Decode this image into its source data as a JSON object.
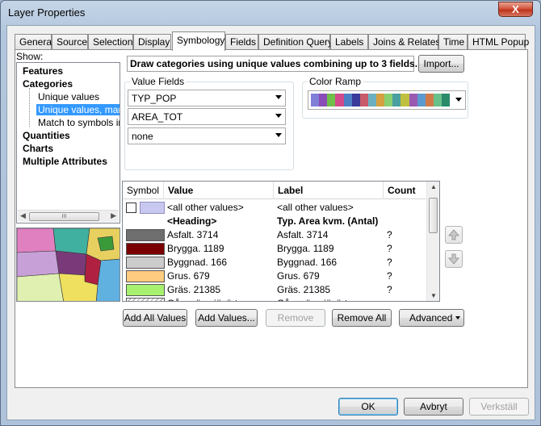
{
  "window": {
    "title": "Layer Properties",
    "close_glyph": "X"
  },
  "tabs": [
    {
      "label": "General"
    },
    {
      "label": "Source"
    },
    {
      "label": "Selection"
    },
    {
      "label": "Display"
    },
    {
      "label": "Symbology"
    },
    {
      "label": "Fields"
    },
    {
      "label": "Definition Query"
    },
    {
      "label": "Labels"
    },
    {
      "label": "Joins & Relates"
    },
    {
      "label": "Time"
    },
    {
      "label": "HTML Popup"
    }
  ],
  "show": {
    "label": "Show:",
    "items": [
      {
        "label": "Features"
      },
      {
        "label": "Categories"
      },
      {
        "label": "Unique values"
      },
      {
        "label": "Unique values, many"
      },
      {
        "label": "Match to symbols in a"
      },
      {
        "label": "Quantities"
      },
      {
        "label": "Charts"
      },
      {
        "label": "Multiple Attributes"
      }
    ],
    "scroll_left": "◀",
    "scroll_right": "▶",
    "scroll_grip": "III"
  },
  "description": "Draw categories using unique values combining up to 3 fields.",
  "import_label": "Import...",
  "value_fields": {
    "label": "Value Fields",
    "fields": [
      "TYP_POP",
      "AREA_TOT",
      "none"
    ]
  },
  "color_ramp": {
    "label": "Color Ramp",
    "colors": [
      "#7f7fd8",
      "#8a4db8",
      "#6fbf4a",
      "#d24a8c",
      "#4d7fc4",
      "#3a3a9a",
      "#c85a6a",
      "#6ab0c0",
      "#d4a040",
      "#8ad070",
      "#4aa0a0",
      "#c0c040",
      "#9a5ab0",
      "#5a9ad0",
      "#d07a4a",
      "#6ac08a",
      "#2a8a6a"
    ]
  },
  "table": {
    "headers": {
      "symbol": "Symbol",
      "value": "Value",
      "label": "Label",
      "count": "Count"
    },
    "rows": [
      {
        "value": "<all other values>",
        "label": "<all other values>",
        "count": "",
        "color": "#c8c8f0",
        "checkbox": true,
        "bold": false
      },
      {
        "value": "<Heading>",
        "label": "Typ. Area kvm. (Antal)",
        "count": "",
        "color": "",
        "checkbox": false,
        "bold": true
      },
      {
        "value": "Asfalt. 3714",
        "label": "Asfalt. 3714",
        "count": "?",
        "color": "#6e6e6e",
        "checkbox": false,
        "bold": false
      },
      {
        "value": "Brygga. 1189",
        "label": "Brygga. 1189",
        "count": "?",
        "color": "#7a0000",
        "checkbox": false,
        "bold": false
      },
      {
        "value": "Byggnad. 166",
        "label": "Byggnad. 166",
        "count": "?",
        "color": "#cccccc",
        "checkbox": false,
        "bold": false
      },
      {
        "value": "Grus. 679",
        "label": "Grus. 679",
        "count": "?",
        "color": "#ffcc80",
        "checkbox": false,
        "bold": false
      },
      {
        "value": "Gräs. 21385",
        "label": "Gräs. 21385",
        "count": "?",
        "color": "#a8f070",
        "checkbox": false,
        "bold": false
      },
      {
        "value": "Gångväg sjövärt...",
        "label": "Gångväg sjövärt...",
        "count": "",
        "color": "#e8e8e8",
        "checkbox": false,
        "bold": false
      }
    ]
  },
  "actions": {
    "add_all": "Add All Values",
    "add_values": "Add Values...",
    "remove": "Remove",
    "remove_all": "Remove All",
    "advanced": "Advanced"
  },
  "dialog": {
    "ok": "OK",
    "cancel": "Avbryt",
    "apply": "Verkställ"
  }
}
